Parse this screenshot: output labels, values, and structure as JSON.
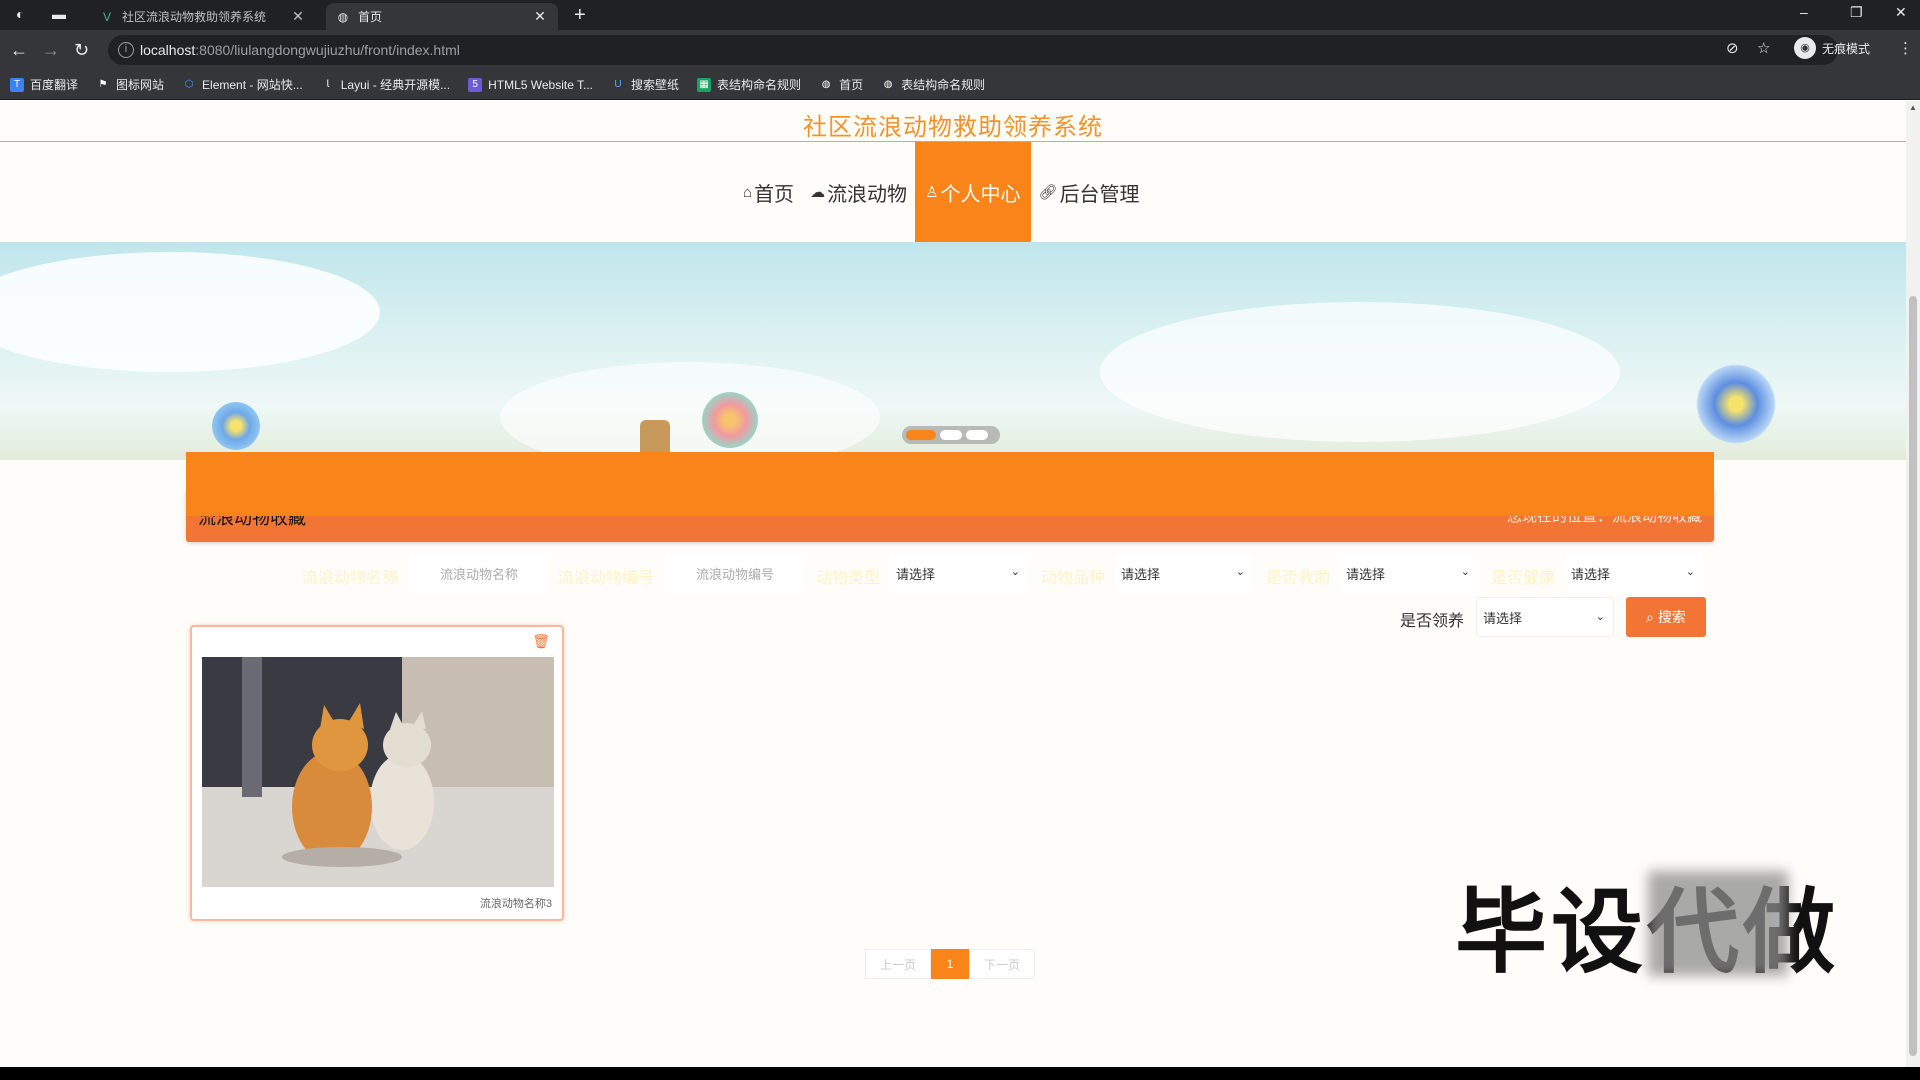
{
  "browser": {
    "tabs": [
      {
        "title": "社区流浪动物救助领养系统",
        "active": false
      },
      {
        "title": "首页",
        "active": true
      }
    ],
    "url_host": "localhost",
    "url_path": ":8080/liulangdongwujiuzhu/front/index.html",
    "profile_label": "无痕模式",
    "bookmarks": [
      {
        "label": "百度翻译",
        "icon": "translate-icon",
        "color": "#3b82f6"
      },
      {
        "label": "图标网站",
        "icon": "flag-icon",
        "color": "#555555"
      },
      {
        "label": "Element - 网站快...",
        "icon": "element-icon",
        "color": "#409eff"
      },
      {
        "label": "Layui - 经典开源模...",
        "icon": "layui-icon",
        "color": "#555555"
      },
      {
        "label": "HTML5 Website T...",
        "icon": "html5-icon",
        "color": "#6b5bd6"
      },
      {
        "label": "搜索壁纸",
        "icon": "wallpaper-icon",
        "color": "#2f6fd6"
      },
      {
        "label": "表结构命名规则",
        "icon": "sheet-icon",
        "color": "#1aa260"
      },
      {
        "label": "首页",
        "icon": "globe-icon",
        "color": "#555555"
      },
      {
        "label": "表结构命名规则",
        "icon": "globe-icon",
        "color": "#555555"
      }
    ]
  },
  "site": {
    "title": "社区流浪动物救助领养系统",
    "nav": [
      {
        "label": "首页",
        "icon": "home-icon",
        "active": false
      },
      {
        "label": "流浪动物",
        "icon": "cloud-icon",
        "active": false
      },
      {
        "label": "个人中心",
        "icon": "user-icon",
        "active": true
      },
      {
        "label": "后台管理",
        "icon": "link-icon",
        "active": false
      }
    ],
    "carousel": {
      "slides": 3,
      "current": 1
    }
  },
  "section": {
    "title": "流浪动物收藏",
    "location_label": "您现在的位置：",
    "location_value": "流浪动物收藏"
  },
  "filters": {
    "name_label": "流浪动物名称",
    "name_placeholder": "流浪动物名称",
    "number_label": "流浪动物编号",
    "number_placeholder": "流浪动物编号",
    "type_label": "动物类型",
    "type_value": "请选择",
    "breed_label": "动物品种",
    "breed_value": "请选择",
    "rescued_label": "是否救助",
    "rescued_value": "请选择",
    "healthy_label": "是否健康",
    "healthy_value": "请选择",
    "adopted_label": "是否领养",
    "adopted_value": "请选择",
    "search_label": "搜索"
  },
  "items": [
    {
      "caption": "流浪动物名称3",
      "image": "two orange and white cats sitting by a wall"
    }
  ],
  "pagination": {
    "prev": "上一页",
    "current": "1",
    "next": "下一页"
  },
  "watermark": {
    "text": "毕设代做"
  },
  "colors": {
    "accent": "#f98419",
    "header_bar": "#f37536",
    "title": "#f39228"
  }
}
